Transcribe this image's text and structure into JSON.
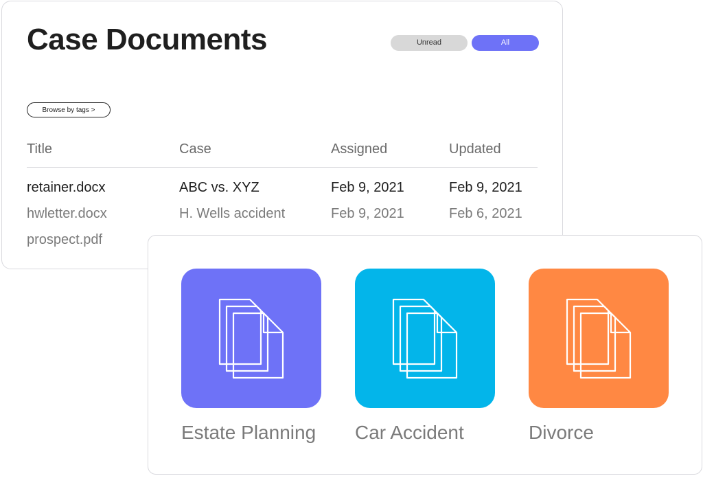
{
  "header": {
    "title": "Case Documents",
    "filters": [
      {
        "label": "Unread",
        "active": false
      },
      {
        "label": "All",
        "active": true
      }
    ],
    "browse_label": "Browse by tags >"
  },
  "table": {
    "columns": [
      "Title",
      "Case",
      "Assigned",
      "Updated"
    ],
    "rows": [
      {
        "title": "retainer.docx",
        "case": "ABC vs. XYZ",
        "assigned": "Feb 9, 2021",
        "updated": "Feb 9, 2021",
        "unread": true
      },
      {
        "title": "hwletter.docx",
        "case": "H. Wells accident",
        "assigned": "Feb 9, 2021",
        "updated": "Feb 6, 2021",
        "unread": false
      },
      {
        "title": "prospect.pdf",
        "case": "",
        "assigned": "",
        "updated": "",
        "unread": false
      }
    ]
  },
  "categories": [
    {
      "label": "Estate Planning",
      "color": "#6e72f7",
      "icon": "documents-icon"
    },
    {
      "label": "Car Accident",
      "color": "#03b5ea",
      "icon": "documents-icon"
    },
    {
      "label": "Divorce",
      "color": "#ff8843",
      "icon": "documents-icon"
    }
  ],
  "colors": {
    "accent": "#6e72f7",
    "pill_inactive": "#d8d8d8",
    "text_dark": "#1f1f1f",
    "text_muted": "#7a7a7a"
  }
}
